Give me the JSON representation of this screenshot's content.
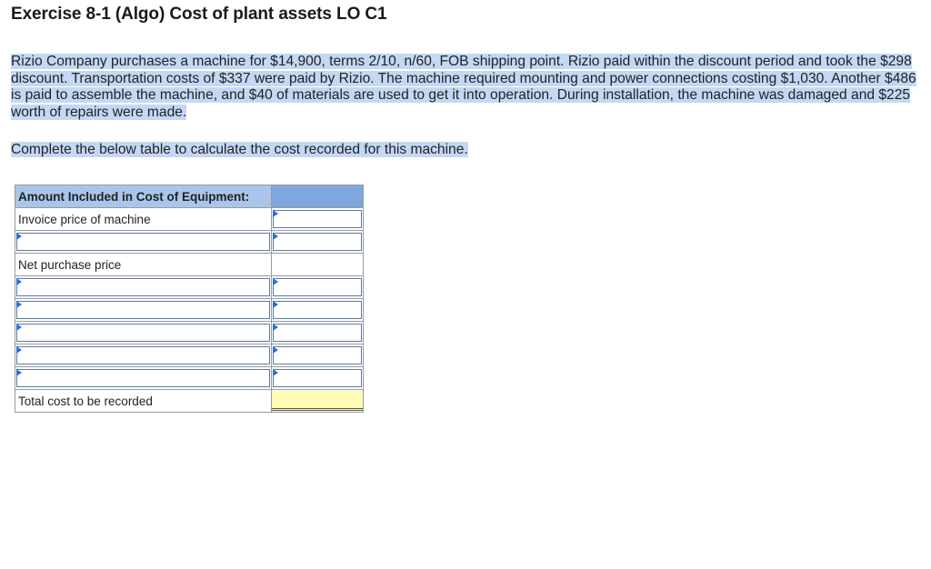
{
  "title": "Exercise 8-1 (Algo) Cost of plant assets LO C1",
  "problem": {
    "paragraph": "Rizio Company purchases a machine for $14,900, terms 2/10, n/60, FOB shipping point. Rizio paid within the discount period and took the $298 discount. Transportation costs of $337 were paid by Rizio. The machine required mounting and power connections costing $1,030. Another $486 is paid to assemble the machine, and $40 of materials are used to get it into operation. During installation, the machine was damaged and $225 worth of repairs were made.",
    "instruction": "Complete the below table to calculate the cost recorded for this machine."
  },
  "table": {
    "header": "Amount Included in Cost of Equipment:",
    "row_invoice": "Invoice price of machine",
    "row_net": "Net purchase price",
    "row_total": "Total cost to be recorded"
  }
}
